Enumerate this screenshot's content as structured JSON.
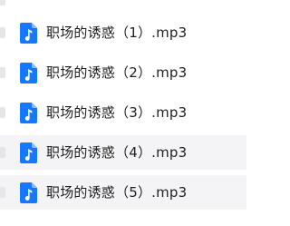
{
  "file_list": {
    "items": [
      {
        "name": "职场的诱惑（1）.mp3",
        "icon": "music-file-icon",
        "highlighted": false
      },
      {
        "name": "职场的诱惑（2）.mp3",
        "icon": "music-file-icon",
        "highlighted": false
      },
      {
        "name": "职场的诱惑（3）.mp3",
        "icon": "music-file-icon",
        "highlighted": false
      },
      {
        "name": "职场的诱惑（4）.mp3",
        "icon": "music-file-icon",
        "highlighted": true
      },
      {
        "name": "职场的诱惑（5）.mp3",
        "icon": "music-file-icon",
        "highlighted": true
      }
    ]
  },
  "colors": {
    "icon_blue": "#1677ff",
    "row_highlight": "#f4f4f6",
    "checkbox": "#e6e6ea"
  }
}
